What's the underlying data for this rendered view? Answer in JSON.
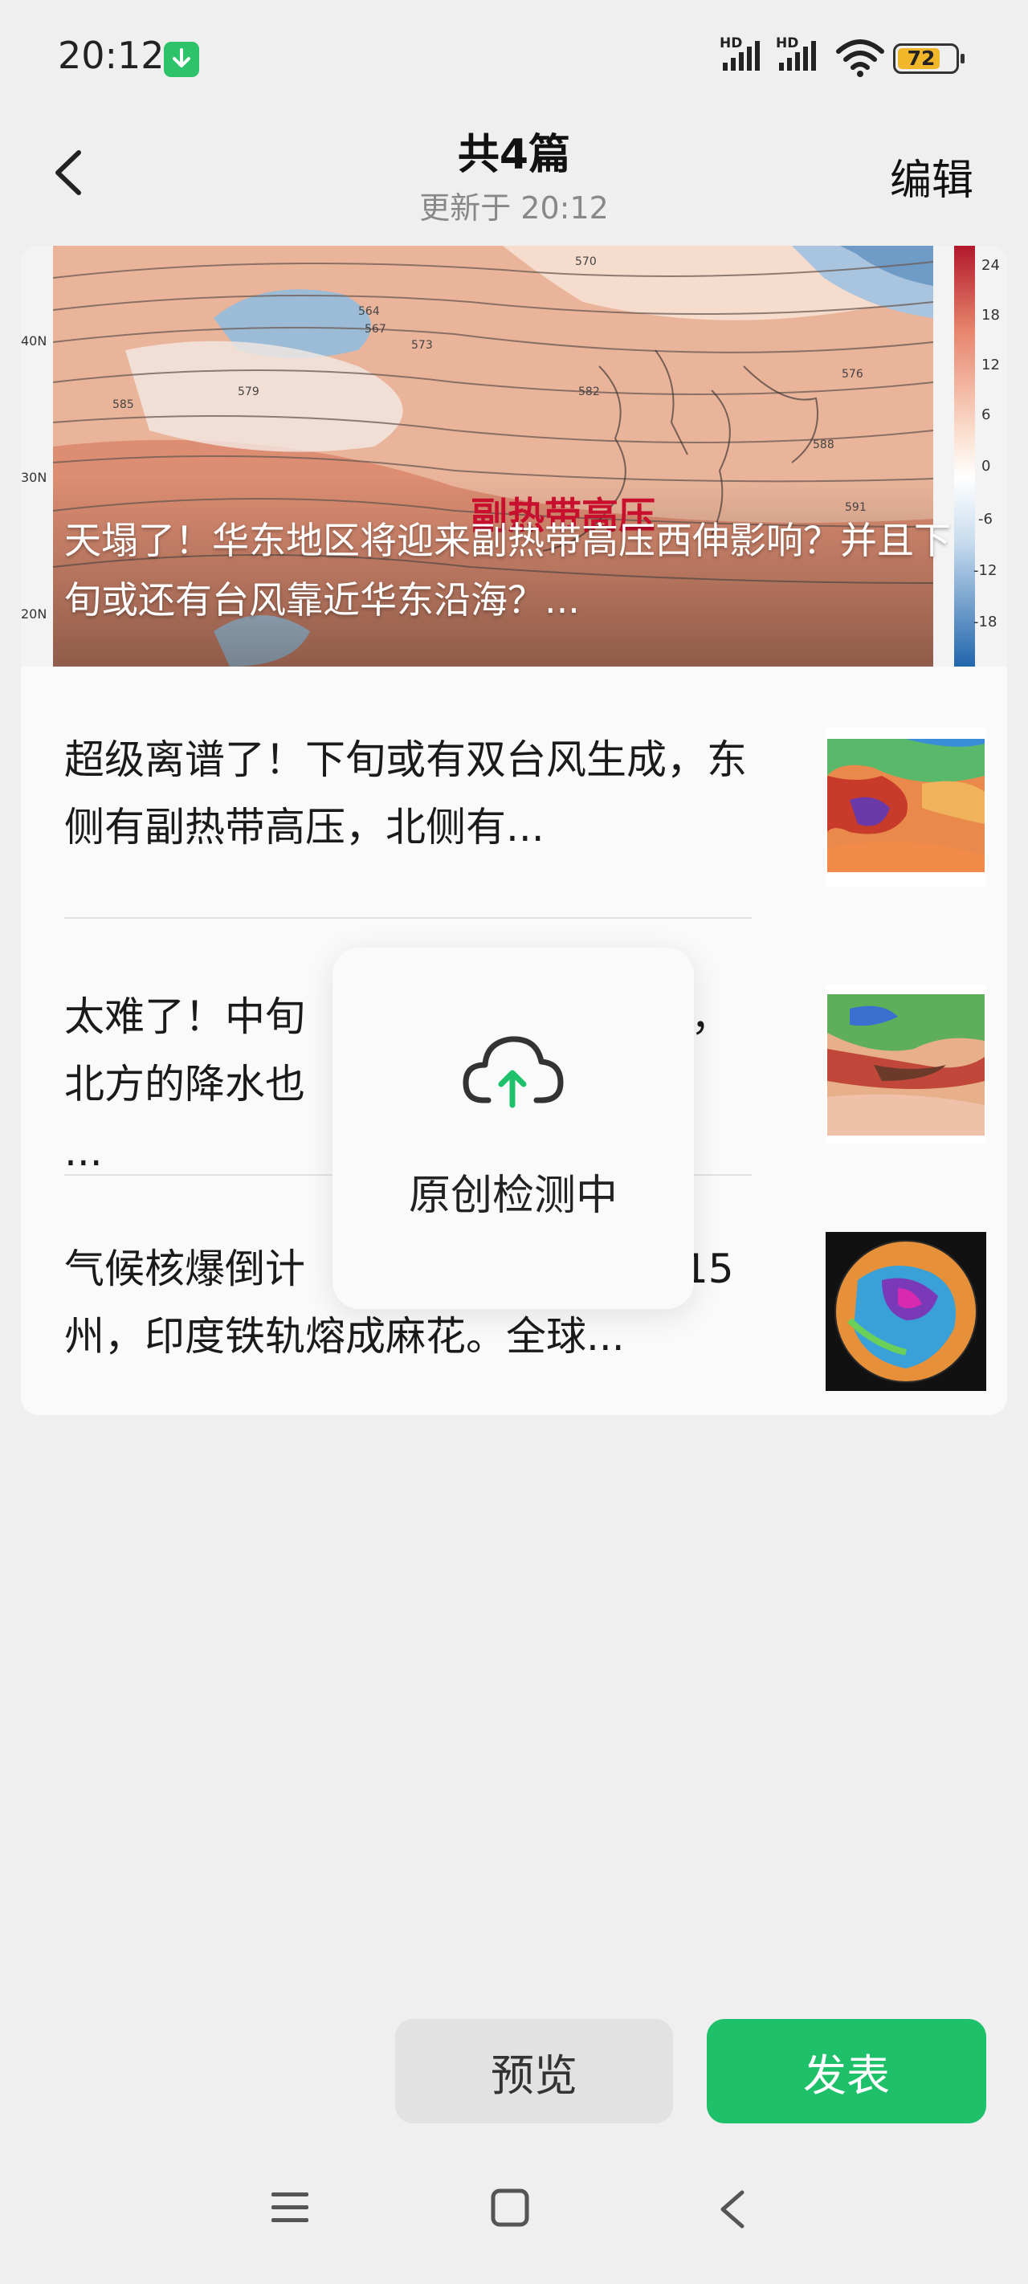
{
  "status_bar": {
    "time": "20:12",
    "network1": "HD",
    "network2": "HD",
    "battery": "72"
  },
  "header": {
    "title": "共4篇",
    "subtitle": "更新于 20:12",
    "edit_label": "编辑"
  },
  "hero": {
    "title": "天塌了！华东地区将迎来副热带高压西伸影响？并且下旬或还有台风靠近华东沿海？...",
    "map_label": "副热带高压",
    "lat_labels": [
      "40N",
      "30N",
      "20N"
    ],
    "scale_labels": [
      "24",
      "18",
      "12",
      "6",
      "0",
      "-6",
      "-12",
      "-18"
    ],
    "contour_labels": [
      "564",
      "567",
      "570",
      "573",
      "576",
      "579",
      "582",
      "585",
      "588",
      "591"
    ]
  },
  "articles": [
    {
      "text": "超级离谱了！下旬或有双台风生成，东侧有副热带高压，北侧有..."
    },
    {
      "text_left": "太难了！中旬",
      "text_right": "，",
      "text_left2": "北方的降水也",
      "text_right2": "..."
    },
    {
      "text_left": "气候核爆倒计",
      "text_right": "15",
      "text_line2": "州，印度铁轨熔成麻花。全球..."
    }
  ],
  "toast": {
    "text": "原创检测中"
  },
  "buttons": {
    "preview": "预览",
    "publish": "发表"
  },
  "colors": {
    "accent": "#1ec16a",
    "background": "#efefef"
  }
}
